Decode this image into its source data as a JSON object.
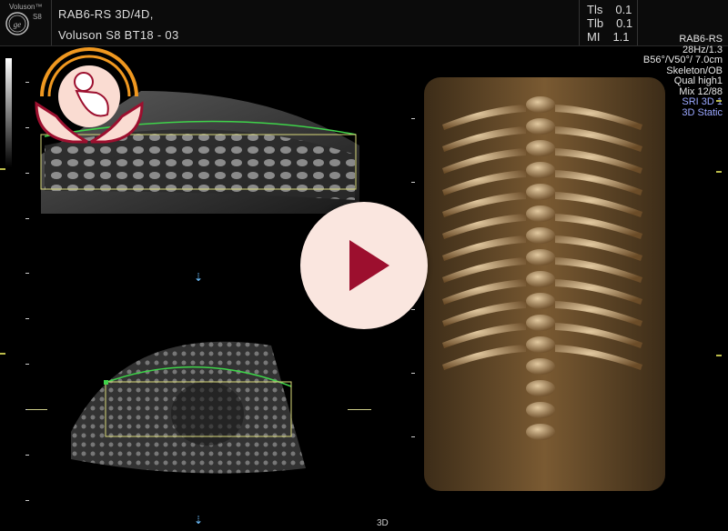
{
  "header": {
    "brand": "Voluson™",
    "brand_model": "S8",
    "probe_line": "RAB6-RS 3D/4D,",
    "device_line": "Voluson S8 BT18 - 03",
    "readouts": [
      {
        "label": "Tls",
        "value": "0.1"
      },
      {
        "label": "Tlb",
        "value": "0.1"
      },
      {
        "label": "MI",
        "value": "1.1"
      }
    ]
  },
  "params": [
    {
      "text": "RAB6-RS",
      "accent": false
    },
    {
      "text": "28Hz/1.3",
      "accent": false
    },
    {
      "text": "B56°/V50°/ 7.0cm",
      "accent": false
    },
    {
      "text": "Skeleton/OB",
      "accent": false
    },
    {
      "text": "Qual high1",
      "accent": false
    },
    {
      "text": "Mix 12/88",
      "accent": false
    },
    {
      "text": "SRI 3D 1",
      "accent": true
    },
    {
      "text": "3D Static",
      "accent": true
    }
  ],
  "mode_label": "3D",
  "colors": {
    "accent_blue": "#9aa7ff",
    "play_bg": "#fae6df",
    "play_icon": "#9c0f2e",
    "roi_box": "#d8d87a",
    "roi_curve": "#3fd34a"
  },
  "icons": [
    "ge-logo-icon",
    "play-icon",
    "baby-logo-icon"
  ]
}
